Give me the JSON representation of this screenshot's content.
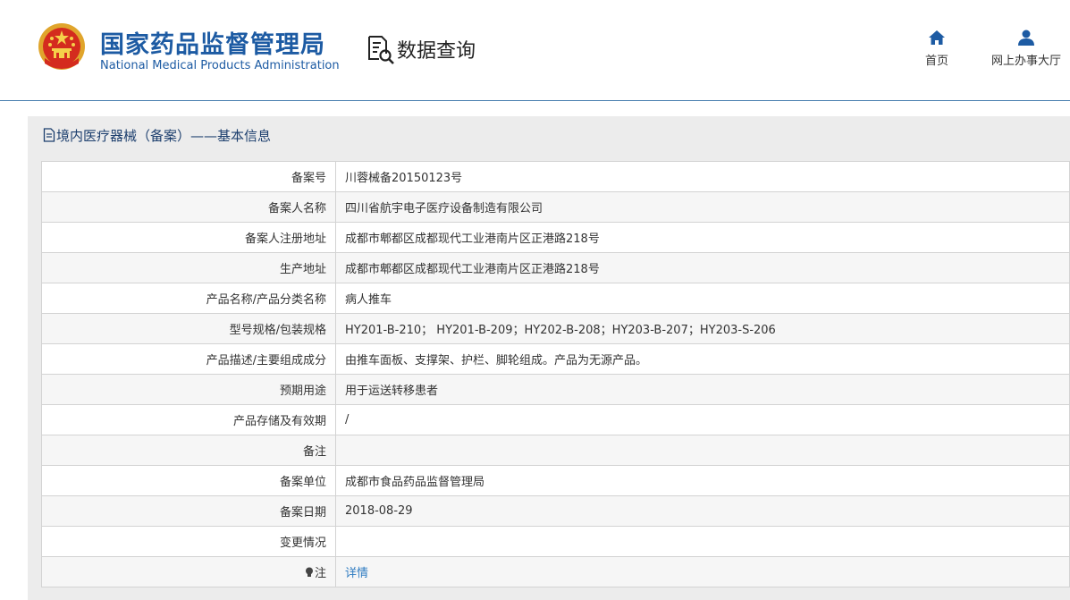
{
  "header": {
    "agency_cn": "国家药品监督管理局",
    "agency_en": "National Medical Products Administration",
    "query_label": "数据查询",
    "nav": [
      {
        "label": "首页",
        "icon": "home-icon"
      },
      {
        "label": "网上办事大厅",
        "icon": "user-icon"
      }
    ]
  },
  "panel": {
    "title": "境内医疗器械（备案）——基本信息"
  },
  "rows": [
    {
      "label": "备案号",
      "value": "川蓉械备20150123号"
    },
    {
      "label": "备案人名称",
      "value": "四川省航宇电子医疗设备制造有限公司"
    },
    {
      "label": "备案人注册地址",
      "value": "成都市郫都区成都现代工业港南片区正港路218号"
    },
    {
      "label": "生产地址",
      "value": "成都市郫都区成都现代工业港南片区正港路218号"
    },
    {
      "label": "产品名称/产品分类名称",
      "value": "病人推车"
    },
    {
      "label": "型号规格/包装规格",
      "value": "HY201-B-210； HY201-B-209；HY202-B-208；HY203-B-207；HY203-S-206"
    },
    {
      "label": "产品描述/主要组成成分",
      "value": "由推车面板、支撑架、护栏、脚轮组成。产品为无源产品。"
    },
    {
      "label": "预期用途",
      "value": "用于运送转移患者"
    },
    {
      "label": "产品存储及有效期",
      "value": "/"
    },
    {
      "label": "备注",
      "value": ""
    },
    {
      "label": "备案单位",
      "value": "成都市食品药品监督管理局"
    },
    {
      "label": "备案日期",
      "value": "2018-08-29"
    },
    {
      "label": "变更情况",
      "value": ""
    }
  ],
  "note_row": {
    "label": "注",
    "link": "详情",
    "icon": "lightbulb-icon"
  },
  "colors": {
    "brand_blue": "#1d5ba3",
    "link_blue": "#2f7cc1",
    "panel_gray": "#ececec"
  }
}
